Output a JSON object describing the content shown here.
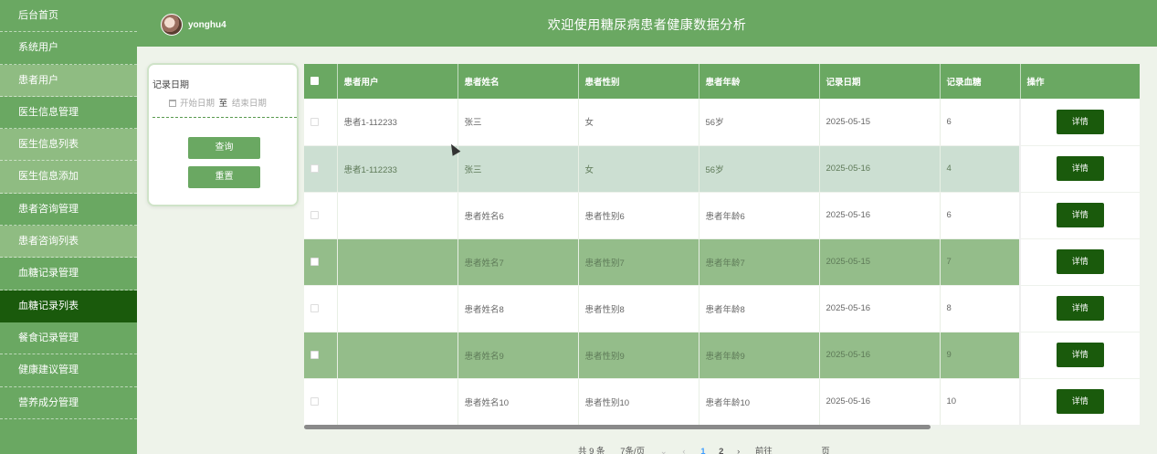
{
  "sidebar": {
    "items": [
      {
        "label": "后台首页"
      },
      {
        "label": "系统用户"
      },
      {
        "label": "患者用户"
      },
      {
        "label": "医生信息管理"
      },
      {
        "label": "医生信息列表"
      },
      {
        "label": "医生信息添加"
      },
      {
        "label": "患者咨询管理"
      },
      {
        "label": "患者咨询列表"
      },
      {
        "label": "血糖记录管理"
      },
      {
        "label": "血糖记录列表"
      },
      {
        "label": "餐食记录管理"
      },
      {
        "label": "健康建议管理"
      },
      {
        "label": "营养成分管理"
      }
    ]
  },
  "header": {
    "username": "yonghu4",
    "title": "欢迎使用糖尿病患者健康数据分析"
  },
  "search": {
    "label": "记录日期",
    "start_placeholder": "开始日期",
    "separator": "至",
    "end_placeholder": "结束日期",
    "query_label": "查询",
    "reset_label": "重置"
  },
  "table": {
    "headers": [
      "患者用户",
      "患者姓名",
      "患者性别",
      "患者年龄",
      "记录日期",
      "记录血糖",
      "操作"
    ],
    "detail_label": "详情",
    "rows": [
      {
        "user": "患者1-112233",
        "name": "张三",
        "gender": "女",
        "age": "56岁",
        "date": "2025-05-15",
        "glucose": "6"
      },
      {
        "user": "患者1-112233",
        "name": "张三",
        "gender": "女",
        "age": "56岁",
        "date": "2025-05-16",
        "glucose": "4"
      },
      {
        "user": "",
        "name": "患者姓名6",
        "gender": "患者性别6",
        "age": "患者年龄6",
        "date": "2025-05-16",
        "glucose": "6"
      },
      {
        "user": "",
        "name": "患者姓名7",
        "gender": "患者性别7",
        "age": "患者年龄7",
        "date": "2025-05-15",
        "glucose": "7"
      },
      {
        "user": "",
        "name": "患者姓名8",
        "gender": "患者性别8",
        "age": "患者年龄8",
        "date": "2025-05-16",
        "glucose": "8"
      },
      {
        "user": "",
        "name": "患者姓名9",
        "gender": "患者性别9",
        "age": "患者年龄9",
        "date": "2025-05-16",
        "glucose": "9"
      },
      {
        "user": "",
        "name": "患者姓名10",
        "gender": "患者性别10",
        "age": "患者年龄10",
        "date": "2025-05-16",
        "glucose": "10"
      }
    ]
  },
  "pager": {
    "total": "共 9 条",
    "page_size": "7条/页",
    "page1": "1",
    "page2": "2",
    "goto": "前往",
    "page_suffix": "页"
  },
  "colors": {
    "primary": "#6aa862",
    "active": "#1a5a0c",
    "row_light": "#ccdfd2",
    "row_dark": "#94bd8a"
  }
}
